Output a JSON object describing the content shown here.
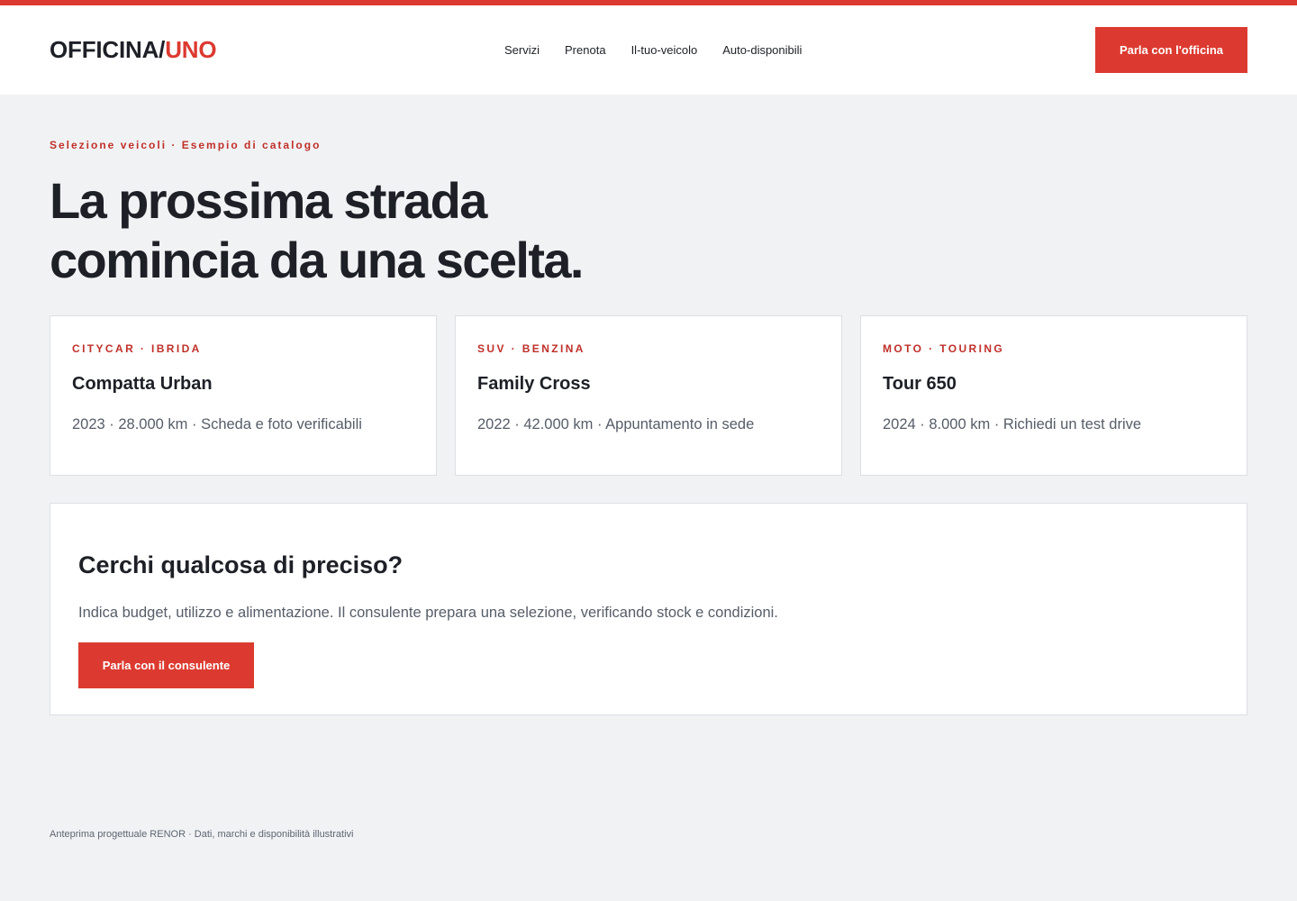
{
  "brand": {
    "name": "OFFICINA/",
    "accent": "UNO",
    "accent_color": "#dc3a30"
  },
  "nav": {
    "items": [
      "Servizi",
      "Prenota",
      "Il-tuo-veicolo",
      "Auto-disponibili"
    ]
  },
  "header": {
    "cta_label": "Parla con l'officina"
  },
  "hero": {
    "eyebrow": "Selezione veicoli · Esempio di catalogo",
    "title_line1": "La prossima strada",
    "title_line2": "comincia da una scelta."
  },
  "cards": [
    {
      "tag": "CITYCAR · IBRIDA",
      "title": "Compatta Urban",
      "meta": "2023 · 28.000 km · Scheda e foto verificabili"
    },
    {
      "tag": "SUV · BENZINA",
      "title": "Family Cross",
      "meta": "2022 · 42.000 km · Appuntamento in sede"
    },
    {
      "tag": "MOTO · TOURING",
      "title": "Tour 650",
      "meta": "2024 · 8.000 km · Richiedi un test drive"
    }
  ],
  "search_panel": {
    "title": "Cerchi qualcosa di preciso?",
    "text": "Indica budget, utilizzo e alimentazione. Il consulente prepara una selezione, verificando stock e condizioni.",
    "cta_label": "Parla con il consulente"
  },
  "footer": {
    "note": "Anteprima progettuale RENOR · Dati, marchi e disponibilità illustrativi"
  }
}
